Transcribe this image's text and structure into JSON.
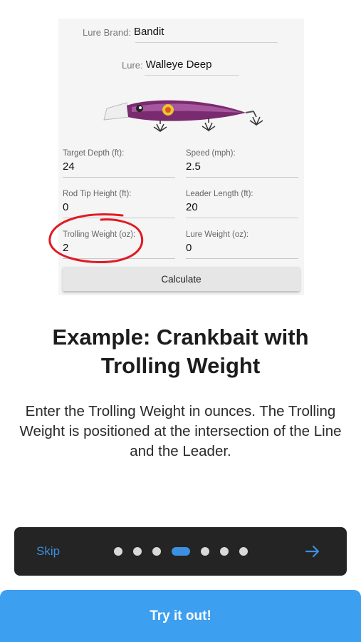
{
  "form": {
    "brand_label": "Lure Brand:",
    "brand_value": "Bandit",
    "lure_label": "Lure:",
    "lure_value": "Walleye Deep",
    "fields": [
      {
        "label": "Target Depth (ft):",
        "value": "24"
      },
      {
        "label": "Speed (mph):",
        "value": "2.5"
      },
      {
        "label": "Rod Tip Height (ft):",
        "value": "0"
      },
      {
        "label": "Leader Length (ft):",
        "value": "20"
      },
      {
        "label": "Trolling Weight (oz):",
        "value": "2"
      },
      {
        "label": "Lure Weight (oz):",
        "value": "0"
      }
    ],
    "calculate_label": "Calculate"
  },
  "headline": "Example: Crankbait with Trolling Weight",
  "description": "Enter the Trolling Weight in ounces. The Trolling Weight is positioned at the intersection of the Line and the Leader.",
  "nav": {
    "skip_label": "Skip",
    "page_count": 7,
    "active_page": 4
  },
  "try_label": "Try it out!",
  "colors": {
    "accent": "#3d8fe0",
    "try_button": "#3d9ff0",
    "highlight_circle": "#e01b24",
    "lure_body": "#7a2a6e"
  },
  "icons": [
    "dropdown-arrow-icon",
    "crankbait-lure-image",
    "arrow-right-icon"
  ]
}
